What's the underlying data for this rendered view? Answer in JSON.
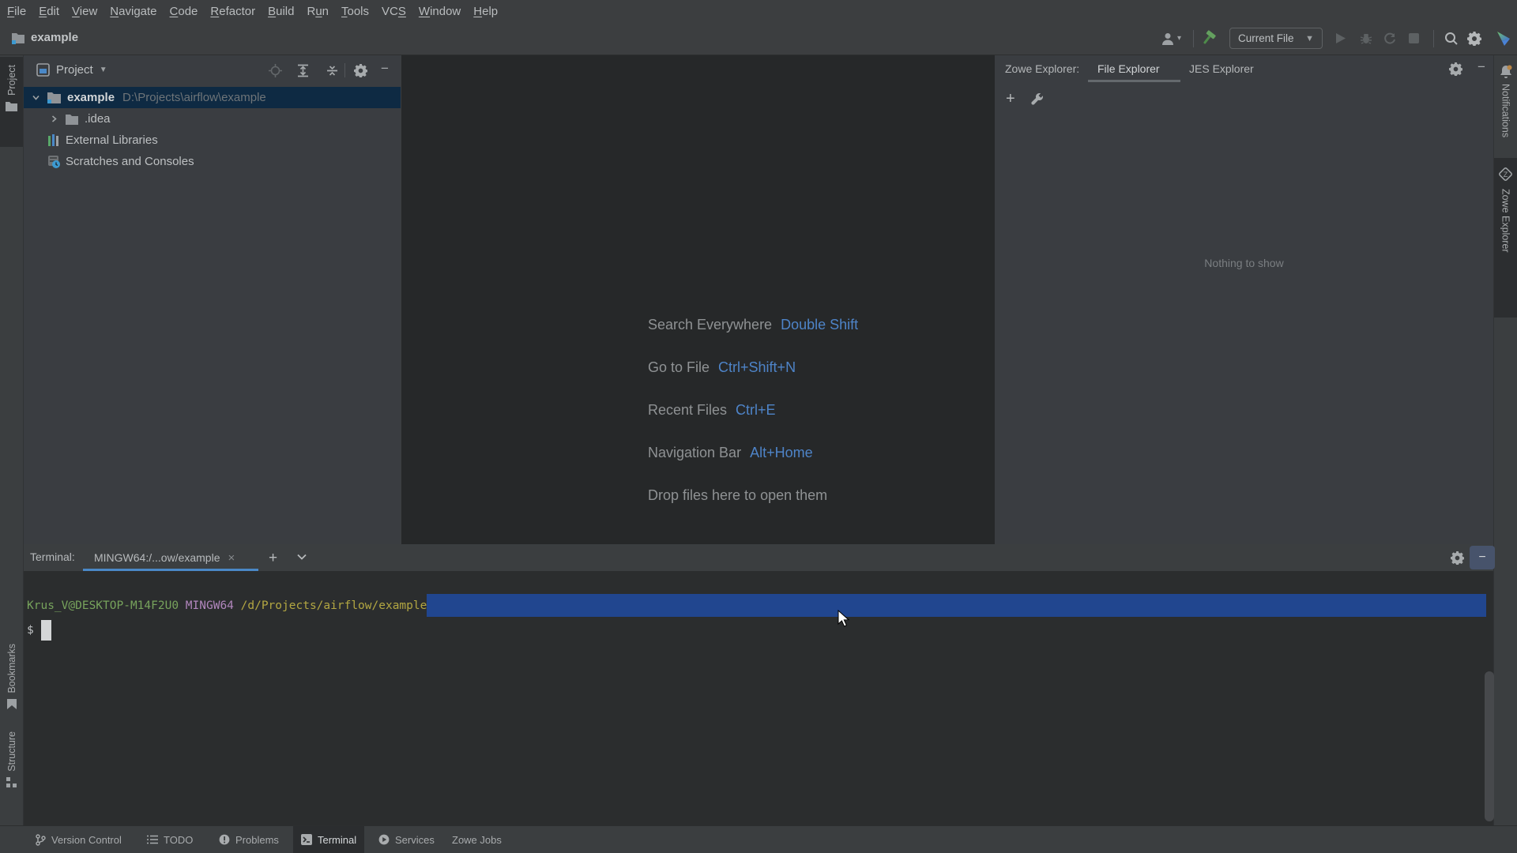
{
  "menubar": {
    "items": [
      {
        "label": "File",
        "mnemonic": 0
      },
      {
        "label": "Edit",
        "mnemonic": 0
      },
      {
        "label": "View",
        "mnemonic": 0
      },
      {
        "label": "Navigate",
        "mnemonic": 0
      },
      {
        "label": "Code",
        "mnemonic": 0
      },
      {
        "label": "Refactor",
        "mnemonic": 0
      },
      {
        "label": "Build",
        "mnemonic": 0
      },
      {
        "label": "Run",
        "mnemonic": 1
      },
      {
        "label": "Tools",
        "mnemonic": 0
      },
      {
        "label": "VCS",
        "mnemonic": 2
      },
      {
        "label": "Window",
        "mnemonic": 0
      },
      {
        "label": "Help",
        "mnemonic": 0
      }
    ]
  },
  "navbar": {
    "project_name": "example",
    "run_config": "Current File"
  },
  "project_panel": {
    "title": "Project",
    "tree": [
      {
        "name": "example",
        "path": "D:\\Projects\\airflow\\example"
      },
      {
        "name": ".idea"
      },
      {
        "name": "External Libraries"
      },
      {
        "name": "Scratches and Consoles"
      }
    ]
  },
  "editor": {
    "hints": [
      {
        "label": "Search Everywhere",
        "shortcut": "Double Shift"
      },
      {
        "label": "Go to File",
        "shortcut": "Ctrl+Shift+N"
      },
      {
        "label": "Recent Files",
        "shortcut": "Ctrl+E"
      },
      {
        "label": "Navigation Bar",
        "shortcut": "Alt+Home"
      },
      {
        "label": "Drop files here to open them",
        "shortcut": ""
      }
    ]
  },
  "zowe_panel": {
    "title": "Zowe Explorer:",
    "tab_file": "File Explorer",
    "tab_jes": "JES Explorer",
    "empty_text": "Nothing to show"
  },
  "strips": {
    "project": "Project",
    "bookmarks": "Bookmarks",
    "structure": "Structure",
    "notifications": "Notifications",
    "zowe": "Zowe Explorer"
  },
  "terminal": {
    "label": "Terminal:",
    "tab": "MINGW64:/...ow/example",
    "prompt_user": "Krus_V@DESKTOP-M14F2U0",
    "prompt_env": "MINGW64",
    "prompt_path": "/d/Projects/airflow/example",
    "prompt_symbol": "$"
  },
  "statusbar": {
    "items": [
      "Version Control",
      "TODO",
      "Problems",
      "Terminal",
      "Services",
      "Zowe Jobs"
    ],
    "active": "Terminal"
  },
  "glyphs": {
    "close": "×",
    "plus": "+",
    "minus": "−",
    "caret_down": "▼"
  },
  "colors": {
    "selection_blue": "#21468f",
    "tree_selection": "#0e2a43",
    "tab_underline": "#4a88c7",
    "hint_shortcut": "#4e84c8",
    "terminal_green": "#77a35c",
    "terminal_purple": "#b186bd",
    "terminal_yellow": "#b3a742"
  }
}
